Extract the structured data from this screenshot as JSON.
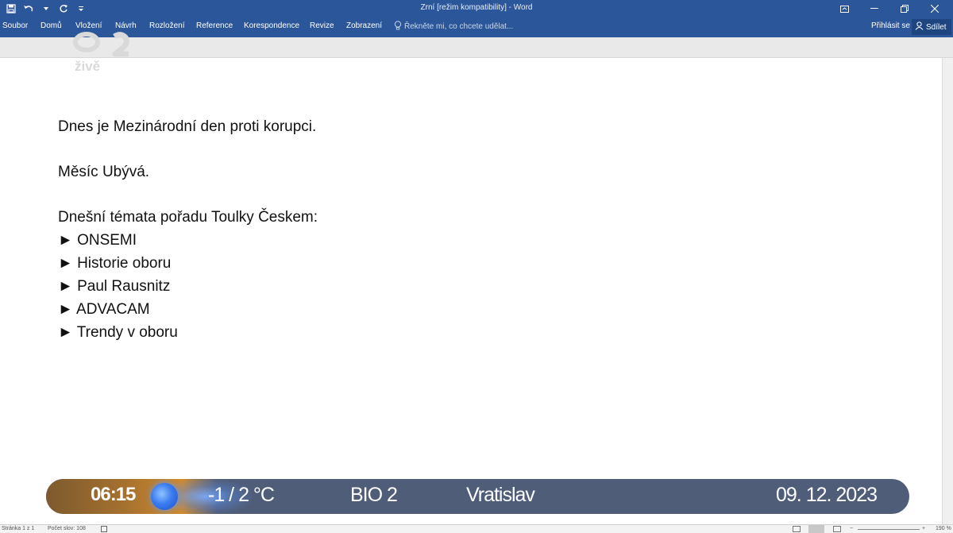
{
  "window": {
    "title": "Zrní [režim kompatibility] - Word"
  },
  "ribbon": {
    "tabs": [
      "Soubor",
      "Domů",
      "Vložení",
      "Návrh",
      "Rozložení",
      "Reference",
      "Korespondence",
      "Revize",
      "Zobrazení"
    ],
    "tell_me_placeholder": "Řekněte mi, co chcete udělat...",
    "sign_in": "Přihlásit se",
    "share": "Sdílet"
  },
  "logo": {
    "text": "živě"
  },
  "document": {
    "line1": "Dnes je Mezinárodní den proti korupci.",
    "line2": "Měsíc Ubývá.",
    "heading": "Dnešní témata pořadu Toulky Českem:",
    "items": [
      "► ONSEMI",
      "► Historie oboru",
      "► Paul Rausnitz",
      "► ADVACAM",
      "► Trendy v oboru"
    ]
  },
  "ticker": {
    "time": "06:15",
    "temperature": "-1 / 2 °C",
    "channel": "BIO 2",
    "location": "Vratislav",
    "date": "09. 12. 2023"
  },
  "statusbar": {
    "page": "Stránka 1 z 1",
    "words": "Počet slov: 108",
    "zoom": "190 %"
  },
  "colors": {
    "ribbon": "#2b579a",
    "ticker": "#4f5d79",
    "time_accent": "#d08a2e",
    "orb": "#3b7cf0"
  }
}
